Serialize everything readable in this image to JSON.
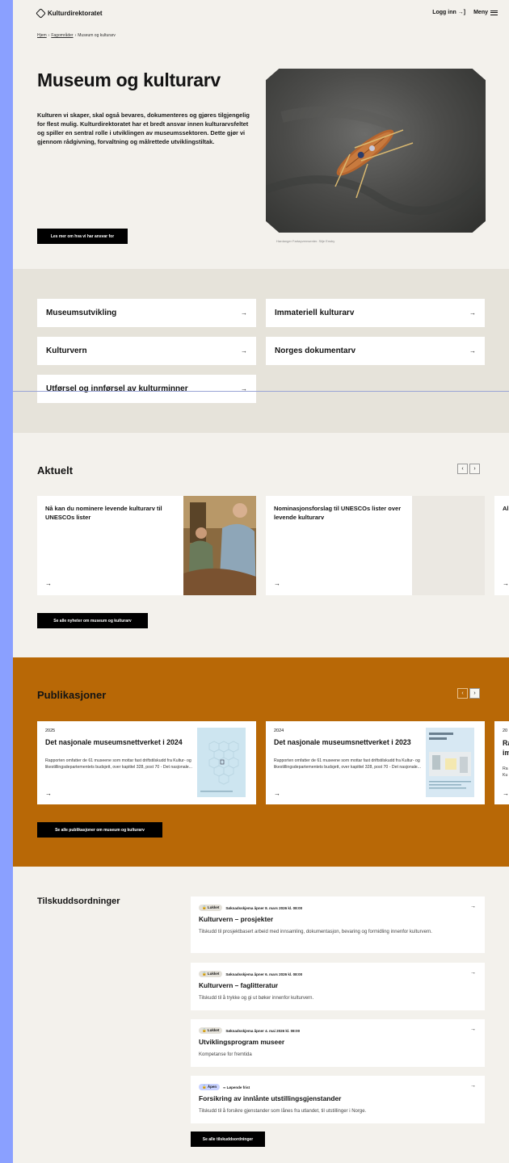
{
  "header": {
    "logo_text": "Kulturdirektoratet",
    "login_label": "Logg inn",
    "login_icon": "→]",
    "menu_label": "Meny"
  },
  "breadcrumb": {
    "home": "Hjem",
    "sep1": "›",
    "section": "Fagområder",
    "sep2": "›",
    "current": "Museum og kulturarv"
  },
  "hero": {
    "title": "Museum og kulturarv",
    "text": "Kulturen vi skaper, skal også bevares, dokumenteres og gjøres tilgjengelig for flest mulig. Kulturdirektoratet har et bredt ansvar innen kulturarvsfeltet og spiller en sentral rolle i utviklingen av museumssektoren. Dette gjør vi gjennom rådgivning, forvaltning og målrettede utviklingstiltak.",
    "button_label": "Les mer om hva vi har ansvar for",
    "image_caption": "Hardanger Fartøyvernsenter. Silje Ensby"
  },
  "links": [
    {
      "label": "Museumsutvikling",
      "arrow": "→"
    },
    {
      "label": "Immateriell kulturarv",
      "arrow": "→"
    },
    {
      "label": "Kulturvern",
      "arrow": "→"
    },
    {
      "label": "Norges dokumentarv",
      "arrow": "→"
    },
    {
      "label": "Utførsel og innførsel av kulturminner",
      "arrow": "→"
    }
  ],
  "aktuelt": {
    "title": "Aktuelt",
    "prev": "‹",
    "next": "›",
    "cards": [
      {
        "title": "Nå kan du nominere levende kulturarv til UNESCOs lister",
        "arrow": "→"
      },
      {
        "title": "Nominasjonsforslag til UNESCOs lister over levende kulturarv",
        "arrow": "→"
      },
      {
        "title": "Al",
        "arrow": "→"
      }
    ],
    "button_label": "Se alle nyheter om museum og kulturarv"
  },
  "publikasjoner": {
    "title": "Publikasjoner",
    "prev": "‹",
    "next": "›",
    "cards": [
      {
        "year": "2025",
        "title": "Det nasjonale museumsnettverket i 2024",
        "desc": "Rapporten omfatter de 61 museene som mottar fast driftstilskudd fra Kultur- og likestillingsdepartementets budsjett, over kapittel 328, post 70 - Det nasjonale...",
        "arrow": "→"
      },
      {
        "year": "2024",
        "title": "Det nasjonale museumsnettverket i 2023",
        "desc": "Rapporten omfatter de 61 museene som mottar fast driftstilskudd fra Kultur- og likestillingsdepartementets budsjett, over kapittel 328, post 70 - Det nasjonale...",
        "arrow": "→"
      },
      {
        "year": "20",
        "title": "Ra\nim",
        "desc": "Ra\nKu",
        "arrow": "→"
      }
    ],
    "button_label": "Se alle publikasjoner om museum og kulturarv"
  },
  "tilskudd": {
    "title": "Tilskuddsordninger",
    "items": [
      {
        "status": "Lukket",
        "meta": "Søknadsskjema åpner 8. mars 2026 kl. 08:00",
        "title": "Kulturvern – prosjekter",
        "desc": "Tilskudd til prosjektbasert arbeid med innsamling, dokumentasjon, bevaring og formidling innenfor kulturvern.",
        "arrow": "→"
      },
      {
        "status": "Lukket",
        "meta": "Søknadsskjema åpner 6. mars 2026 kl. 08:00",
        "title": "Kulturvern – faglitteratur",
        "desc": "Tilskudd til å trykke og gi ut bøker innenfor kulturvern.",
        "arrow": "→"
      },
      {
        "status": "Lukket",
        "meta": "Søknadsskjema åpner 4. mai 2026 kl. 08:00",
        "title": "Utviklingsprogram museer",
        "desc": "Kompetanse for fremtida",
        "arrow": "→"
      },
      {
        "status": "Åpen",
        "meta": "∞ Løpende frist",
        "title": "Forsikring av innlånte utstillingsgjenstander",
        "desc": "Tilskudd til å forsikre gjenstander som lånes fra utlandet, til utstillinger i Norge.",
        "arrow": "→"
      }
    ],
    "button_label": "Se alle tilskuddsordninger"
  }
}
